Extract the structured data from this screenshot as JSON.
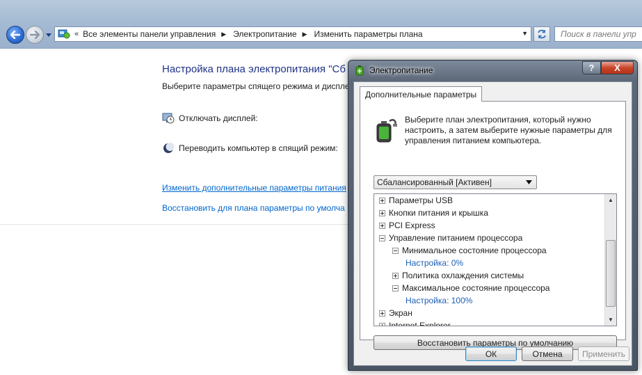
{
  "explorer": {
    "breadcrumbs": [
      "Все элементы панели управления",
      "Электропитание",
      "Изменить параметры плана"
    ],
    "overflow_marker": "«",
    "search_placeholder": "Поиск в панели упр"
  },
  "page": {
    "title": "Настройка плана электропитания \"Сб",
    "subtitle": "Выберите параметры спящего режима и диспле",
    "settings": [
      {
        "label": "Отключать дисплей:",
        "icon": "monitor-clock-icon"
      },
      {
        "label": "Переводить компьютер в спящий режим:",
        "icon": "moon-icon"
      }
    ],
    "links": {
      "advanced": "Изменить дополнительные параметры питания",
      "restore": "Восстановить для плана параметры по умолча"
    }
  },
  "dialog": {
    "title": "Электропитание",
    "help_glyph": "?",
    "close_glyph": "X",
    "tab": "Дополнительные параметры",
    "description": "Выберите план электропитания, который нужно настроить, а затем выберите нужные параметры для управления питанием компьютера.",
    "plan_selected": "Сбалансированный [Активен]",
    "tree": [
      {
        "label": "Параметры USB",
        "level": 0,
        "expander": "plus"
      },
      {
        "label": "Кнопки питания и крышка",
        "level": 0,
        "expander": "plus"
      },
      {
        "label": "PCI Express",
        "level": 0,
        "expander": "plus"
      },
      {
        "label": "Управление питанием процессора",
        "level": 0,
        "expander": "minus"
      },
      {
        "label": "Минимальное состояние процессора",
        "level": 1,
        "expander": "minus"
      },
      {
        "label": "Настройка: 0%",
        "level": 2,
        "expander": "none"
      },
      {
        "label": "Политика охлаждения системы",
        "level": 1,
        "expander": "plus"
      },
      {
        "label": "Максимальное состояние процессора",
        "level": 1,
        "expander": "minus"
      },
      {
        "label": "Настройка: 100%",
        "level": 2,
        "expander": "none"
      },
      {
        "label": "Экран",
        "level": 0,
        "expander": "plus"
      },
      {
        "label": "Internet Explorer",
        "level": 0,
        "expander": "plus"
      }
    ],
    "restore_button": "Восстановить параметры по умолчанию",
    "ok_button": "ОК",
    "cancel_button": "Отмена",
    "apply_button": "Применить"
  },
  "colors": {
    "link": "#0066cc",
    "title": "#1e3287",
    "tree_value": "#1c5fb5"
  }
}
